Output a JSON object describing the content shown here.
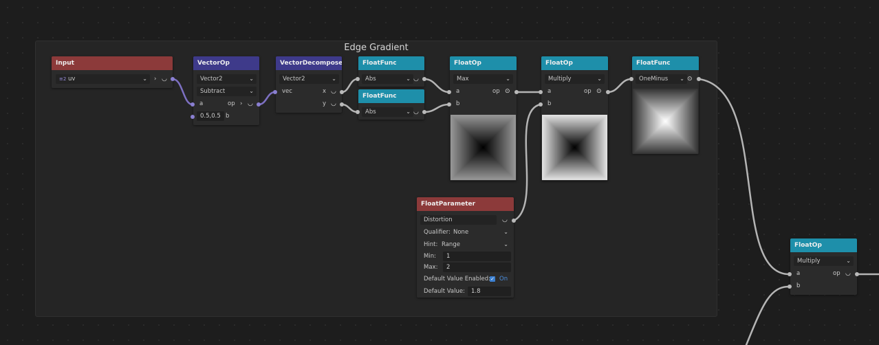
{
  "frame": {
    "title": "Edge Gradient"
  },
  "nodes": {
    "input": {
      "title": "Input",
      "type_badge": "≡2",
      "value": "uv",
      "arrow": "›"
    },
    "vectorop": {
      "title": "VectorOp",
      "type": "Vector2",
      "operation": "Subtract",
      "in_a": "a",
      "out_op": "op",
      "arrow": "›",
      "b_value": "0.5,0.5",
      "in_b": "b"
    },
    "vectordecompose": {
      "title": "VectorDecompose",
      "type": "Vector2",
      "in_vec": "vec",
      "out_x": "x",
      "out_y": "y"
    },
    "floatfunc1": {
      "title": "FloatFunc",
      "func": "Abs"
    },
    "floatfunc2": {
      "title": "FloatFunc",
      "func": "Abs"
    },
    "floatop_max": {
      "title": "FloatOp",
      "operation": "Max",
      "in_a": "a",
      "out_op": "op",
      "in_b": "b"
    },
    "floatop_mul": {
      "title": "FloatOp",
      "operation": "Multiply",
      "in_a": "a",
      "out_op": "op",
      "in_b": "b"
    },
    "floatfunc3": {
      "title": "FloatFunc",
      "func": "OneMinus"
    },
    "floatparam": {
      "title": "FloatParameter",
      "name": "Distortion",
      "qualifier_label": "Qualifier:",
      "qualifier_value": "None",
      "hint_label": "Hint:",
      "hint_value": "Range",
      "min_label": "Min:",
      "min_value": "1",
      "max_label": "Max:",
      "max_value": "2",
      "default_enabled_label": "Default Value Enabled:",
      "default_enabled_value": "On",
      "default_value_label": "Default Value:",
      "default_value": "1.8"
    },
    "floatop_right": {
      "title": "FloatOp",
      "operation": "Multiply",
      "in_a": "a",
      "out_op": "op",
      "in_b": "b"
    }
  },
  "colors": {
    "input_header": "#8c3a3a",
    "vector_header": "#3e3a8a",
    "float_header": "#1e8faa",
    "vector_wire": "#7d70c2",
    "float_wire": "#b5b5b5",
    "checkbox": "#3b7fd0"
  },
  "icons": {
    "chevron": "chevron-down-icon",
    "eye": "eye-icon",
    "connect": "connector-icon"
  }
}
